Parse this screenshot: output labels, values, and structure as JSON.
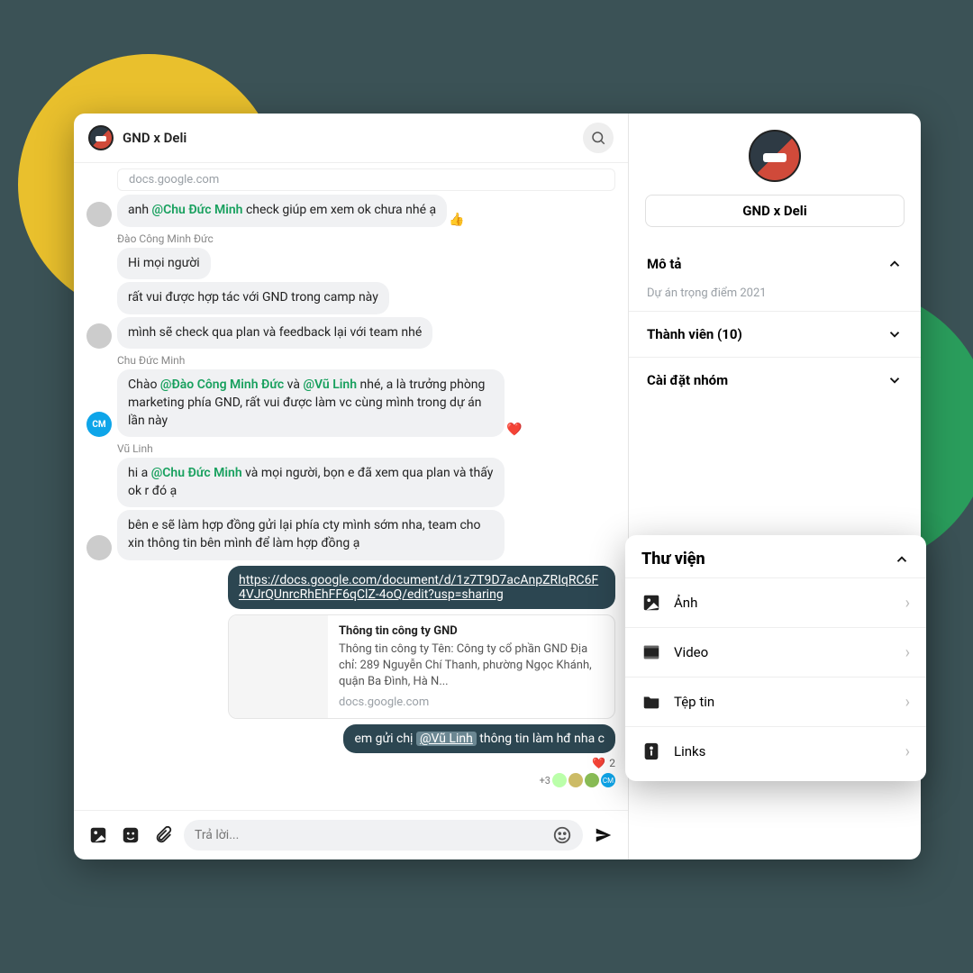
{
  "header": {
    "title": "GND x Deli"
  },
  "link_preview_source": "docs.google.com",
  "messages": {
    "m1": {
      "text_before": "anh ",
      "mention": "@Chu Đức Minh",
      "text_after": " check giúp em xem ok chưa nhé ạ",
      "reaction": "👍"
    },
    "s2": "Đào Công Minh Đức",
    "m2a": "Hi mọi người",
    "m2b": "rất vui được hợp tác với GND trong camp này",
    "m2c": "mình sẽ check qua plan và feedback lại với team nhé",
    "s3": "Chu Đức Minh",
    "m3": {
      "pre": "Chào ",
      "mention1": "@Đào Công Minh Đức",
      "mid": " và ",
      "mention2": "@Vũ Linh",
      "post": " nhé, a là trưởng phòng marketing phía GND, rất vui được làm vc cùng mình trong dự án lần này",
      "reaction": "❤️"
    },
    "s4": "Vũ Linh",
    "m4a": {
      "pre": "hi a ",
      "mention": "@Chu Đức Minh",
      "post": " và mọi người, bọn e đã xem qua plan và thấy ok r đó ạ"
    },
    "m4b": "bên e sẽ làm hợp đồng gửi lại phía cty mình sớm nha, team cho xin thông tin bên mình để làm hợp đồng ạ",
    "link": "https://docs.google.com/document/d/1z7T9D7acAnpZRIqRC6F4VJrQUnrcRhEhFF6qClZ-4oQ/edit?usp=sharing",
    "card": {
      "title": "Thông tin công ty GND",
      "desc": "Thông tin công ty Tên: Công ty cổ phần GND Địa chỉ: 289 Nguyễn Chí Thanh, phường Ngọc Khánh, quận Ba Đình, Hà N...",
      "source": "docs.google.com"
    },
    "m5": {
      "pre": "em gửi chị ",
      "mention": "@Vũ Linh",
      "post": " thông tin làm hđ nha c"
    },
    "react_right": {
      "emoji": "❤️",
      "count": "2"
    },
    "seen_more": "+3"
  },
  "composer": {
    "placeholder": "Trả lời..."
  },
  "side": {
    "group_name": "GND x Deli",
    "sections": {
      "desc_label": "Mô tả",
      "desc_text": "Dự án trọng điểm 2021",
      "members_label": "Thành viên (10)",
      "settings_label": "Cài đặt nhóm"
    }
  },
  "library": {
    "title": "Thư viện",
    "items": {
      "images": "Ảnh",
      "video": "Video",
      "files": "Tệp tin",
      "links": "Links"
    }
  },
  "avatar_initials": {
    "cm": "CM"
  }
}
